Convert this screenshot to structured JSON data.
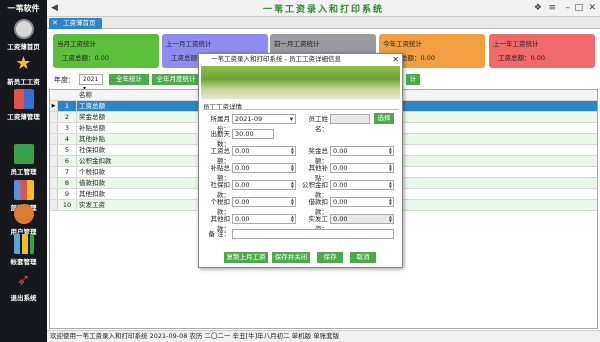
{
  "app": {
    "brand": "一苇软件",
    "title": "一苇工资录入和打印系统"
  },
  "sidebar": {
    "items": [
      {
        "label": "工资薄首页",
        "icon": "compass-icon",
        "color": "#d9d9d9"
      },
      {
        "label": "新员工工资",
        "icon": "star-icon",
        "color": "#f0c020"
      },
      {
        "label": "工资薄管理",
        "icon": "grid-icon",
        "color": "#e0524a"
      },
      {
        "label": "员工管理",
        "icon": "book-icon",
        "color": "#3aa24a"
      },
      {
        "label": "部门管理",
        "icon": "chart-icon",
        "color": "#5b8fd9"
      },
      {
        "label": "用户管理",
        "icon": "users-icon",
        "color": "#e07a30"
      },
      {
        "label": "帐套管理",
        "icon": "bars-icon",
        "color": "#57a6d9"
      },
      {
        "label": "退出系统",
        "icon": "rocket-icon",
        "color": "#cc4a4a"
      }
    ]
  },
  "tabs": {
    "home": "工资薄首页"
  },
  "cards": [
    {
      "title": "当月工资统计",
      "value": "工资总额：0.00",
      "color": "#5cbf3c"
    },
    {
      "title": "上一月工资统计",
      "value": "工资总额：0.00",
      "color": "#8f8cf0"
    },
    {
      "title": "前一月工资统计",
      "value": "",
      "color": "#9a9aa0"
    },
    {
      "title": "今年工资统计",
      "value": "工资总额：0.00",
      "color": "#f0a040"
    },
    {
      "title": "上一年工资统计",
      "value": "工资总额：0.00",
      "color": "#f06a6a"
    }
  ],
  "filter": {
    "label": "年度：",
    "year": "2021",
    "btn_year": "全年统计",
    "btn_month": "全年月度统计",
    "btn_right": "计"
  },
  "grid": {
    "header": "名称",
    "rows": [
      {
        "num": "1",
        "name": "工资总额"
      },
      {
        "num": "2",
        "name": "奖金总额"
      },
      {
        "num": "3",
        "name": "补贴总额"
      },
      {
        "num": "4",
        "name": "其他补贴"
      },
      {
        "num": "5",
        "name": "社保扣款"
      },
      {
        "num": "6",
        "name": "公积金扣款"
      },
      {
        "num": "7",
        "name": "个税扣款"
      },
      {
        "num": "8",
        "name": "借款扣款"
      },
      {
        "num": "9",
        "name": "其他扣款"
      },
      {
        "num": "10",
        "name": "实发工资"
      }
    ]
  },
  "status": "欢迎使用一苇工资录入和打印系统    2021-09-08  农历 二〇二一 辛丑[牛]年八月初二  单机版  单账套版",
  "dialog": {
    "title": "一苇工资录入和打印系统 - 员工工资详细信息",
    "section": "员工工资详情",
    "month_label": "所属月份：",
    "month": "2021-09",
    "name_label": "员工姓名：",
    "name": "",
    "select_btn": "选择",
    "days_label": "出勤天数：",
    "days": "30.00",
    "salary_label": "工资总额：",
    "salary": "0.00",
    "bonus_label": "奖金总额：",
    "bonus": "0.00",
    "allow_label": "补贴总额：",
    "allow": "0.00",
    "other_allow_label": "其他补贴：",
    "other_allow": "0.00",
    "social_label": "社保扣款：",
    "social": "0.00",
    "fund_label": "公积金扣款：",
    "fund": "0.00",
    "tax_label": "个税扣款：",
    "tax": "0.00",
    "loan_label": "借款扣款：",
    "loan": "0.00",
    "other_ded_label": "其他扣款：",
    "other_ded": "0.00",
    "net_label": "实发工资：",
    "net": "0.00",
    "note_label": "备  注：",
    "note": "",
    "btn_copy": "复制上月工资",
    "btn_save_close": "保存并关闭",
    "btn_save": "保存",
    "btn_cancel": "取消"
  }
}
